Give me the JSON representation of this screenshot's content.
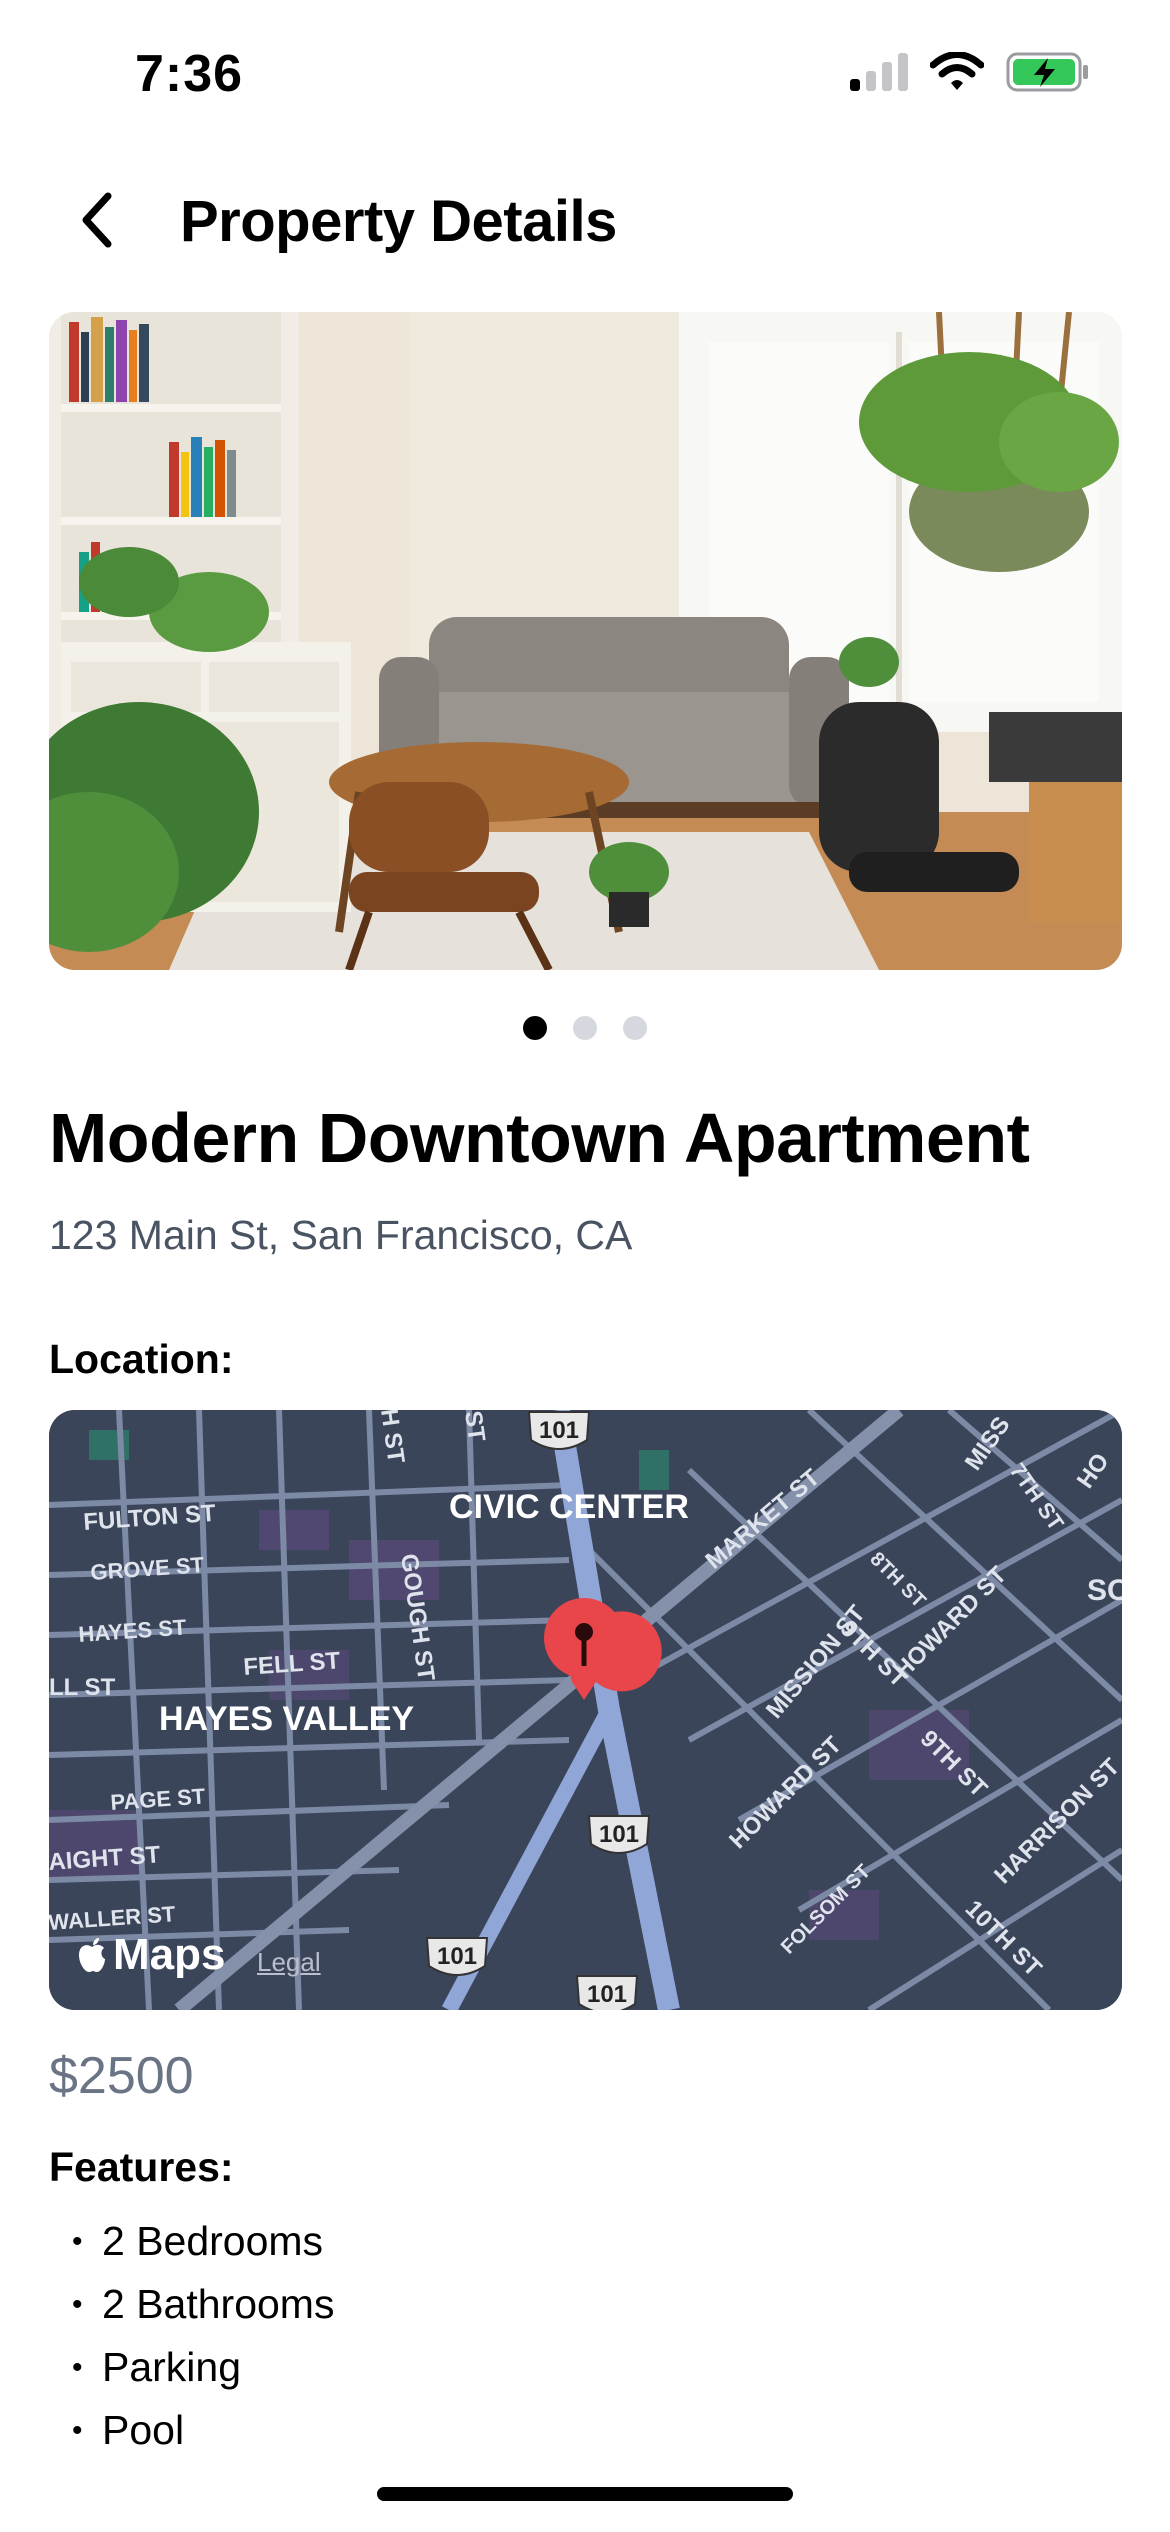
{
  "status_bar": {
    "time": "7:36"
  },
  "nav": {
    "title": "Property Details",
    "back_icon": "chevron-left-icon"
  },
  "gallery": {
    "image": "living-room-photo",
    "active_index": 0,
    "count": 3
  },
  "property": {
    "title": "Modern Downtown Apartment",
    "address": "123 Main St, San Francisco, CA",
    "location_label": "Location:",
    "price": "$2500",
    "features_label": "Features:",
    "features": [
      "2 Bedrooms",
      "2 Bathrooms",
      "Parking",
      "Pool"
    ],
    "bullet": "•"
  },
  "map": {
    "provider": "Maps",
    "legal": "Legal",
    "labels": {
      "civic_center": "CIVIC CENTER",
      "hayes_valley": "HAYES VALLEY",
      "fulton_st": "FULTON ST",
      "grove_st": "GROVE ST",
      "hayes_st": "HAYES ST",
      "fell_st": "FELL ST",
      "ll_st": "LL ST",
      "page_st": "PAGE ST",
      "aight_st": "AIGHT ST",
      "waller_st": "WALLER ST",
      "gough_st": "GOUGH ST",
      "h_st": "H ST",
      "st_top": "ST",
      "market_st": "MARKET ST",
      "mission_st": "MISSION ST",
      "eighth_st": "8TH ST",
      "ninth_st": "9TH ST",
      "ninth_st_2": "9TH ST",
      "howard_st": "HOWARD ST",
      "howard_st_2": "HOWARD ST",
      "seventh_st": "7TH ST",
      "miss": "MISS",
      "ho": "HO",
      "so": "SO",
      "harrison_st": "HARRISON ST",
      "folsom_st": "FOLSOM ST",
      "tenth_st": "10TH ST",
      "hwy_101_a": "101",
      "hwy_101_b": "101",
      "hwy_101_c": "101",
      "hwy_101_d": "101"
    },
    "colors": {
      "background": "#3b455a",
      "road": "#7d8aa6",
      "highway": "#8fa6d6",
      "pin": "#e8464a"
    }
  },
  "colors": {
    "secondary_text": "#4a5361",
    "price_text": "#6b7484",
    "battery": "#34c759"
  }
}
